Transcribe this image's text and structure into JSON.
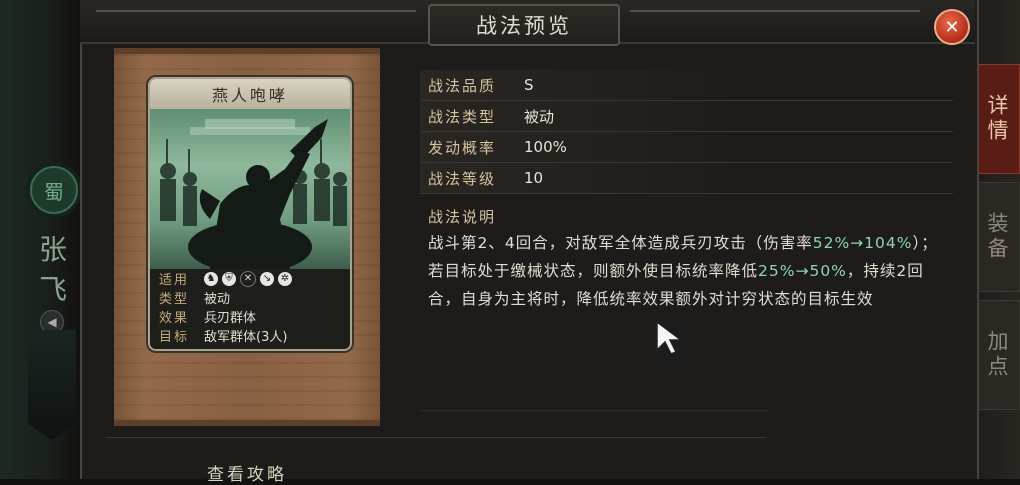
{
  "header": {
    "title": "战法预览",
    "close_icon": "close-icon"
  },
  "left_char": {
    "faction": "蜀",
    "name": "张飞"
  },
  "right_tabs": [
    {
      "label": "详情",
      "active": true
    },
    {
      "label": "装备",
      "active": false
    },
    {
      "label": "加点",
      "active": false
    }
  ],
  "card": {
    "name": "燕人咆哮",
    "info": [
      {
        "key": "适用",
        "value": ""
      },
      {
        "key": "类型",
        "value": "被动"
      },
      {
        "key": "效果",
        "value": "兵刃群体"
      },
      {
        "key": "目标",
        "value": "敌军群体(3人)"
      }
    ],
    "troop_icons": [
      "cavalry-icon",
      "shield-icon",
      "archer-icon-disabled",
      "spear-icon",
      "siege-icon"
    ]
  },
  "props": [
    {
      "key": "战法品质",
      "value": "S"
    },
    {
      "key": "战法类型",
      "value": "被动"
    },
    {
      "key": "发动概率",
      "value": "100%"
    },
    {
      "key": "战法等级",
      "value": "10"
    }
  ],
  "desc": {
    "label": "战法说明",
    "seg1": "战斗第2、4回合，对敌军全体造成兵刃攻击（伤害率",
    "hl1": "52%→104%",
    "seg2": "）；若目标处于缴械状态，则额外使目标统率降低",
    "hl2": "25%→50%",
    "seg3": "，持续2回合，自身为主将时，降低统率效果额外对计穷状态的目标生效"
  },
  "footer": {
    "guide": "查看攻略"
  },
  "colors": {
    "highlight": "#8fd4b4",
    "close": "#c2321c",
    "active_tab": "#5a1d16"
  }
}
